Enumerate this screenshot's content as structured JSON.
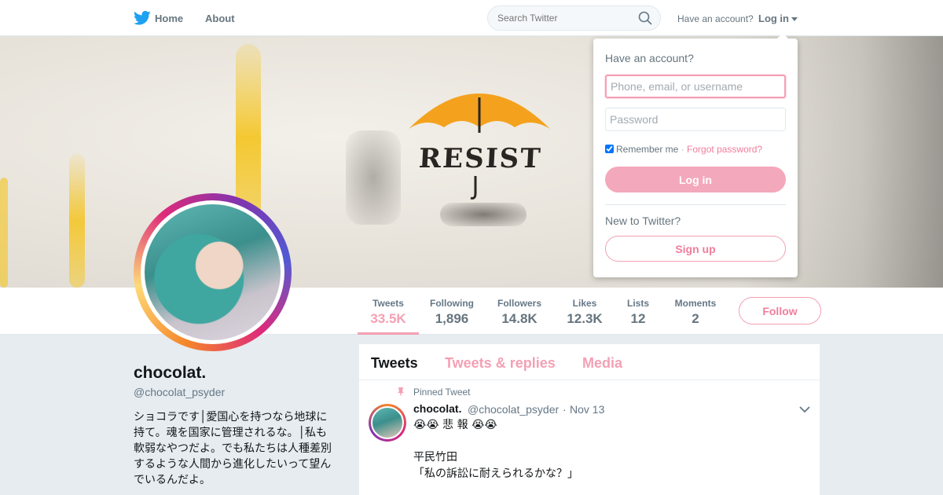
{
  "nav": {
    "logo_icon": "twitter-bird-icon",
    "home_label": "Home",
    "about_label": "About",
    "search_placeholder": "Search Twitter",
    "have_account": "Have an account?",
    "login_label": "Log in",
    "brand_color": "#1da1f2"
  },
  "banner": {
    "word": "RESIST"
  },
  "profile": {
    "name": "chocolat.",
    "handle": "@chocolat_psyder",
    "bio": "ショコラです│愛国心を持つなら地球に持て。魂を国家に管理されるな。│私も軟弱なやつだよ。でも私たちは人種差別するような人間から進化したいって望んでいるんだよ。",
    "accent_color": "#f4a0b4"
  },
  "stats": [
    {
      "label": "Tweets",
      "value": "33.5K",
      "active": true
    },
    {
      "label": "Following",
      "value": "1,896"
    },
    {
      "label": "Followers",
      "value": "14.8K"
    },
    {
      "label": "Likes",
      "value": "12.3K"
    },
    {
      "label": "Lists",
      "value": "12"
    },
    {
      "label": "Moments",
      "value": "2"
    }
  ],
  "follow_label": "Follow",
  "timeline": {
    "tabs": [
      "Tweets",
      "Tweets & replies",
      "Media"
    ],
    "pinned_label": "Pinned Tweet",
    "tweet": {
      "name": "chocolat.",
      "handle": "@chocolat_psyder",
      "separator": "·",
      "date": "Nov 13",
      "lines": [
        "😭😭 悲 報 😭😭",
        "平民竹田",
        "「私の訴訟に耐えられるかな？」"
      ]
    }
  },
  "login_dropdown": {
    "heading": "Have an account?",
    "username_placeholder": "Phone, email, or username",
    "password_placeholder": "Password",
    "remember_label": "Remember me",
    "separator": "·",
    "forgot_label": "Forgot password?",
    "login_button": "Log in",
    "new_heading": "New to Twitter?",
    "signup_button": "Sign up"
  }
}
